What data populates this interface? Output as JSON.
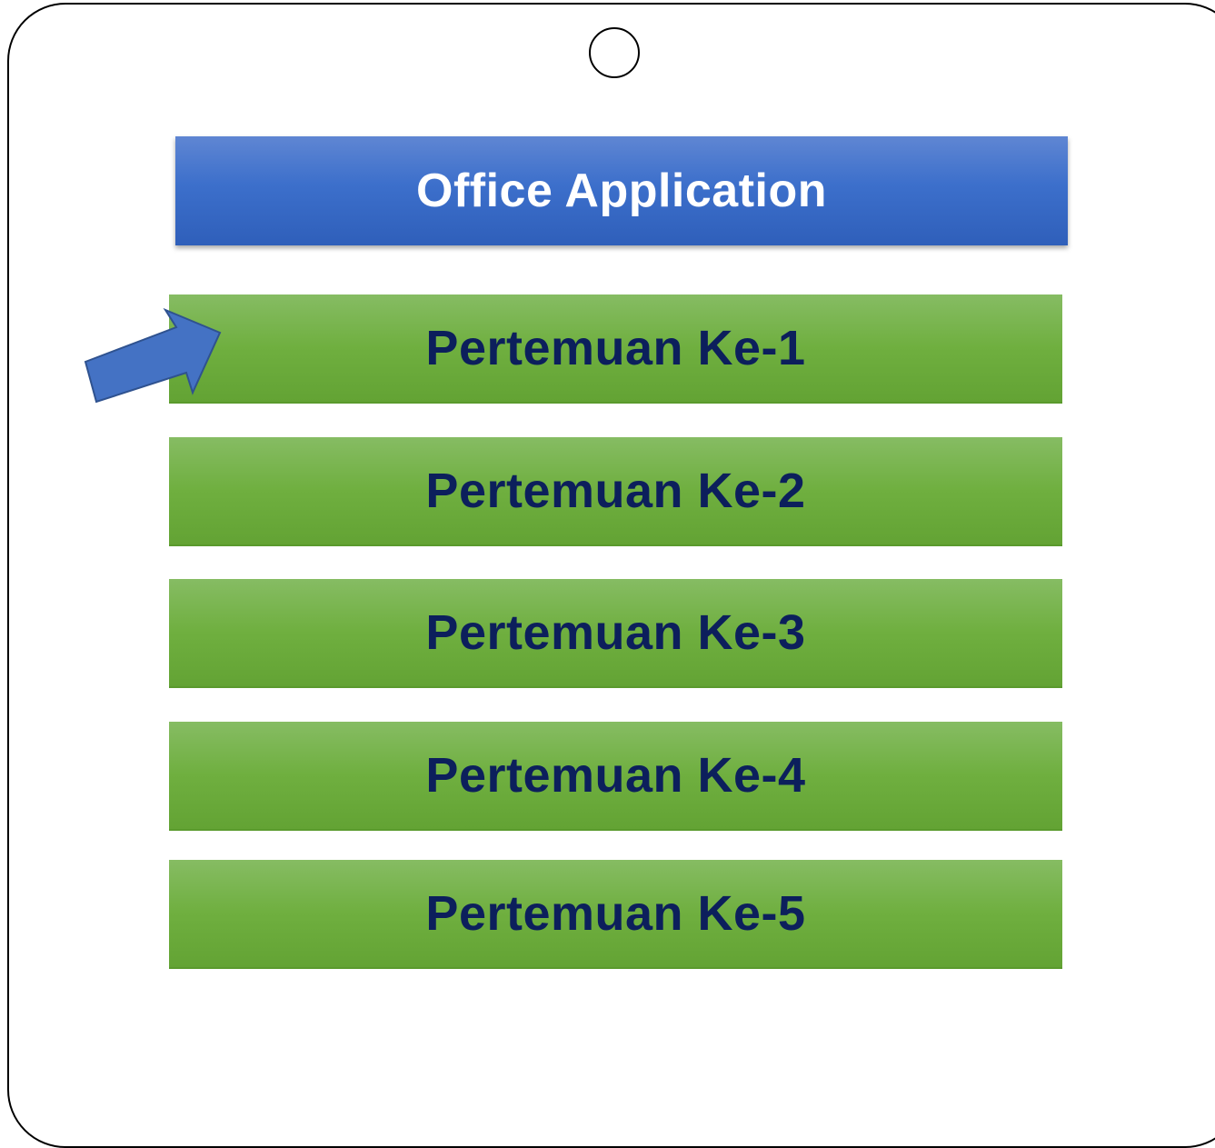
{
  "header": {
    "title": "Office Application"
  },
  "menu": {
    "items": [
      {
        "label": "Pertemuan Ke-1"
      },
      {
        "label": "Pertemuan Ke-2"
      },
      {
        "label": "Pertemuan Ke-3"
      },
      {
        "label": "Pertemuan Ke-4"
      },
      {
        "label": "Pertemuan Ke-5"
      }
    ],
    "selected_index": 0
  },
  "colors": {
    "header_bg": "#3c6fcb",
    "item_bg": "#6faf3f",
    "item_text": "#0c1f5c",
    "arrow": "#4472c4"
  },
  "icons": {
    "pointer": "arrow-pointer-icon",
    "camera": "camera-circle-icon"
  }
}
